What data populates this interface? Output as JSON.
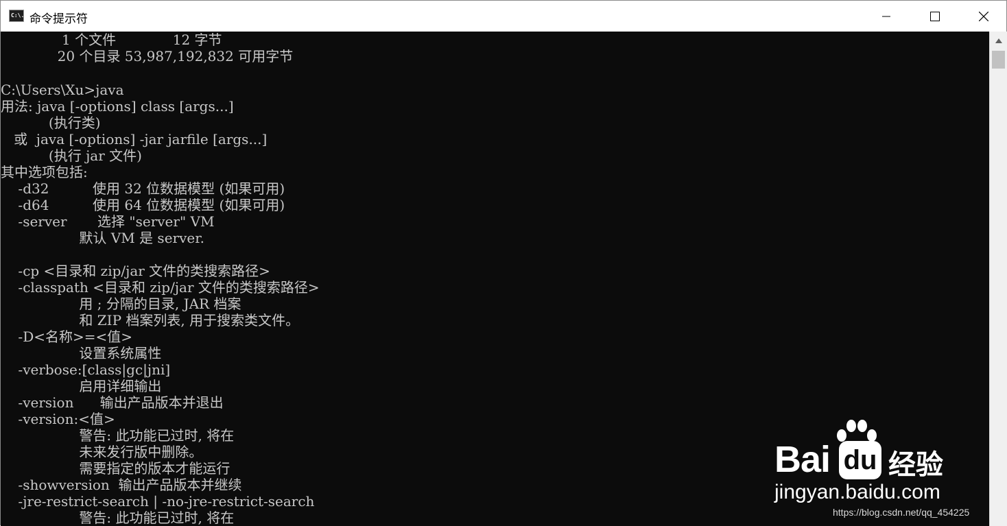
{
  "window": {
    "title": "命令提示符",
    "icon_text": "C:\\.",
    "controls": {
      "minimize_icon": "minimize-icon",
      "maximize_icon": "maximize-icon",
      "close_icon": "close-icon"
    }
  },
  "console": {
    "lines": [
      "              1 个文件             12 字节",
      "             20 个目录 53,987,192,832 可用字节",
      "",
      "C:\\Users\\Xu>java",
      "用法: java [-options] class [args...]",
      "           (执行类)",
      "   或  java [-options] -jar jarfile [args...]",
      "           (执行 jar 文件)",
      "其中选项包括:",
      "    -d32          使用 32 位数据模型 (如果可用)",
      "    -d64          使用 64 位数据模型 (如果可用)",
      "    -server       选择 \"server\" VM",
      "                  默认 VM 是 server.",
      "",
      "    -cp <目录和 zip/jar 文件的类搜索路径>",
      "    -classpath <目录和 zip/jar 文件的类搜索路径>",
      "                  用 ; 分隔的目录, JAR 档案",
      "                  和 ZIP 档案列表, 用于搜索类文件。",
      "    -D<名称>=<值>",
      "                  设置系统属性",
      "    -verbose:[class|gc|jni]",
      "                  启用详细输出",
      "    -version      输出产品版本并退出",
      "    -version:<值>",
      "                  警告: 此功能已过时, 将在",
      "                  未来发行版中删除。",
      "                  需要指定的版本才能运行",
      "    -showversion  输出产品版本并继续",
      "    -jre-restrict-search | -no-jre-restrict-search",
      "                  警告: 此功能已过时, 将在"
    ]
  },
  "watermark": {
    "bai": "Bai",
    "du": "du",
    "jingyan": "经验",
    "url": "jingyan.baidu.com"
  },
  "source_note": "https://blog.csdn.net/qq_454225",
  "colors": {
    "console_bg": "#0c0c0c",
    "console_text": "#c8c8c8",
    "titlebar_bg": "#ffffff"
  }
}
